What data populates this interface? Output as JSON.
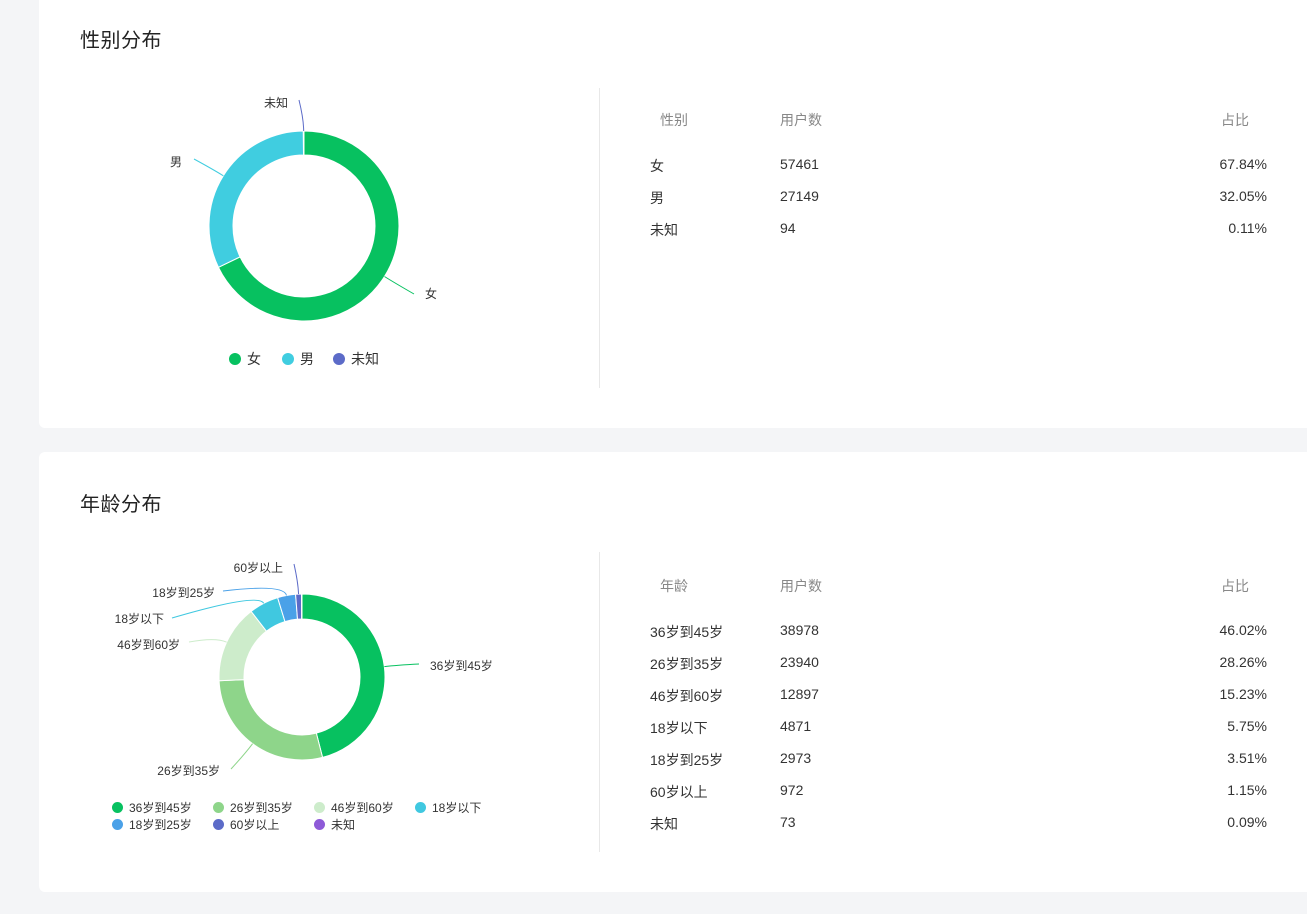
{
  "gender": {
    "title": "性别分布",
    "table": {
      "headers": [
        "性别",
        "用户数",
        "占比"
      ],
      "rows": [
        {
          "label": "女",
          "count": "57461",
          "pct": "67.84%"
        },
        {
          "label": "男",
          "count": "27149",
          "pct": "32.05%"
        },
        {
          "label": "未知",
          "count": "94",
          "pct": "0.11%"
        }
      ]
    }
  },
  "age": {
    "title": "年龄分布",
    "table": {
      "headers": [
        "年龄",
        "用户数",
        "占比"
      ],
      "rows": [
        {
          "label": "36岁到45岁",
          "count": "38978",
          "pct": "46.02%"
        },
        {
          "label": "26岁到35岁",
          "count": "23940",
          "pct": "28.26%"
        },
        {
          "label": "46岁到60岁",
          "count": "12897",
          "pct": "15.23%"
        },
        {
          "label": "18岁以下",
          "count": "4871",
          "pct": "5.75%"
        },
        {
          "label": "18岁到25岁",
          "count": "2973",
          "pct": "3.51%"
        },
        {
          "label": "60岁以上",
          "count": "972",
          "pct": "1.15%"
        },
        {
          "label": "未知",
          "count": "73",
          "pct": "0.09%"
        }
      ]
    }
  },
  "chart_data": [
    {
      "type": "pie",
      "title": "性别分布",
      "donut": true,
      "categories": [
        "女",
        "男",
        "未知"
      ],
      "values": [
        57461,
        27149,
        94
      ],
      "colors": [
        "#07c160",
        "#40cde0",
        "#5c6bc8"
      ],
      "legend": [
        "女",
        "男",
        "未知"
      ],
      "legend_position": "bottom"
    },
    {
      "type": "pie",
      "title": "年龄分布",
      "donut": true,
      "categories": [
        "36岁到45岁",
        "26岁到35岁",
        "46岁到60岁",
        "18岁以下",
        "18岁到25岁",
        "60岁以上",
        "未知"
      ],
      "values": [
        38978,
        23940,
        12897,
        4871,
        2973,
        972,
        73
      ],
      "colors": [
        "#07c160",
        "#8ed58a",
        "#cdeccb",
        "#40c8e0",
        "#4aa1e8",
        "#5c6bc8",
        "#8e5ad8"
      ],
      "legend": [
        "36岁到45岁",
        "26岁到35岁",
        "46岁到60岁",
        "18岁以下",
        "18岁到25岁",
        "60岁以上",
        "未知"
      ],
      "legend_position": "bottom"
    }
  ]
}
